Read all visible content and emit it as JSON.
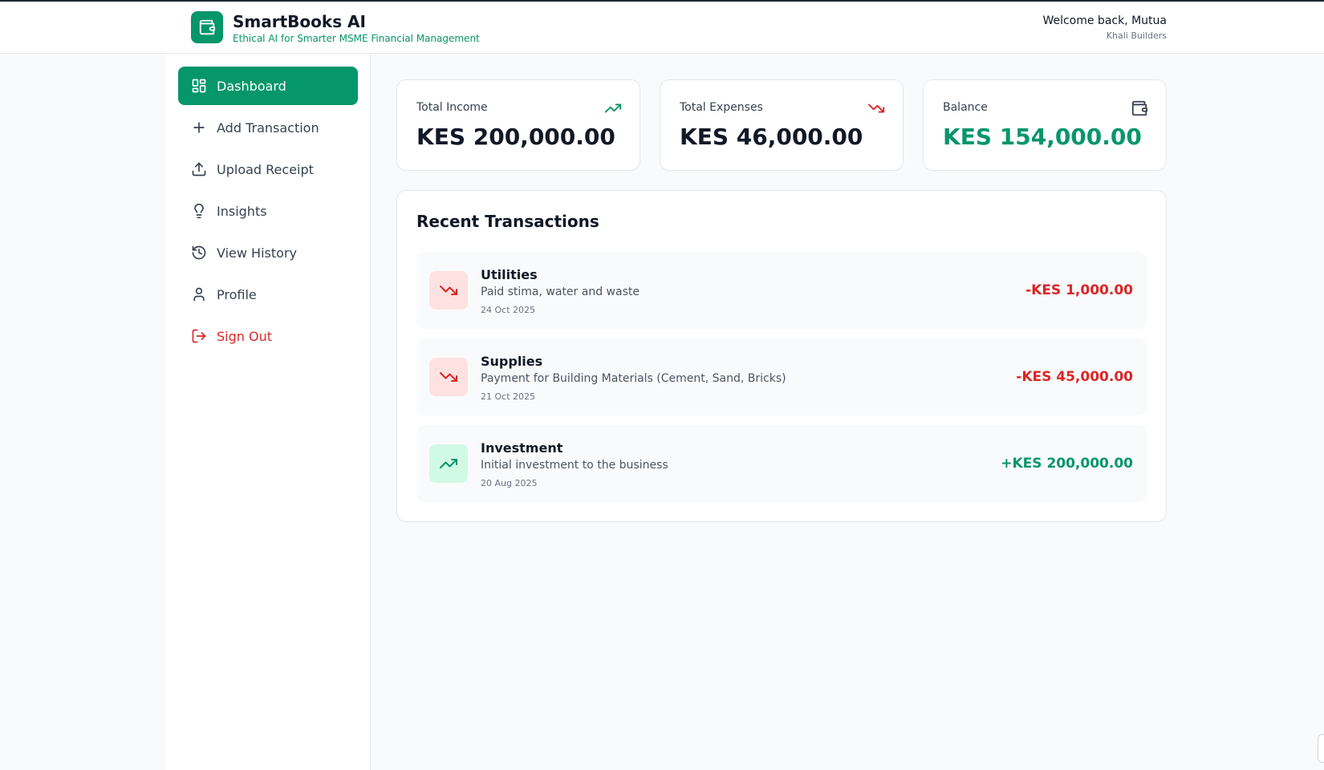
{
  "header": {
    "title": "SmartBooks AI",
    "subtitle": "Ethical AI for Smarter MSME Financial Management",
    "welcome": "Welcome back, Mutua",
    "company": "Khali Builders",
    "logo_icon": "wallet-icon"
  },
  "sidebar": {
    "items": [
      {
        "label": "Dashboard",
        "icon": "dashboard-grid-icon",
        "active": true
      },
      {
        "label": "Add Transaction",
        "icon": "plus-icon"
      },
      {
        "label": "Upload Receipt",
        "icon": "upload-icon"
      },
      {
        "label": "Insights",
        "icon": "lightbulb-icon"
      },
      {
        "label": "View History",
        "icon": "history-icon"
      },
      {
        "label": "Profile",
        "icon": "user-icon"
      },
      {
        "label": "Sign Out",
        "icon": "sign-out-icon"
      }
    ]
  },
  "stats": {
    "income": {
      "label": "Total Income",
      "value": "KES 200,000.00",
      "icon": "trending-up-icon"
    },
    "expenses": {
      "label": "Total Expenses",
      "value": "KES 46,000.00",
      "icon": "trending-down-icon"
    },
    "balance": {
      "label": "Balance",
      "value": "KES 154,000.00",
      "icon": "wallet-icon"
    }
  },
  "recent": {
    "title": "Recent Transactions",
    "transactions": [
      {
        "category": "Utilities",
        "description": "Paid stima, water and waste",
        "date": "24 Oct 2025",
        "amount": "-KES 1,000.00",
        "type": "expense"
      },
      {
        "category": "Supplies",
        "description": "Payment for Building Materials (Cement, Sand, Bricks)",
        "date": "21 Oct 2025",
        "amount": "-KES 45,000.00",
        "type": "expense"
      },
      {
        "category": "Investment",
        "description": "Initial investment to the business",
        "date": "20 Aug 2025",
        "amount": "+KES 200,000.00",
        "type": "income"
      }
    ]
  },
  "colors": {
    "accent": "#059669",
    "expense": "#dc2626",
    "expense_bg": "#fee2e2",
    "income_bg": "#d1fae5"
  }
}
